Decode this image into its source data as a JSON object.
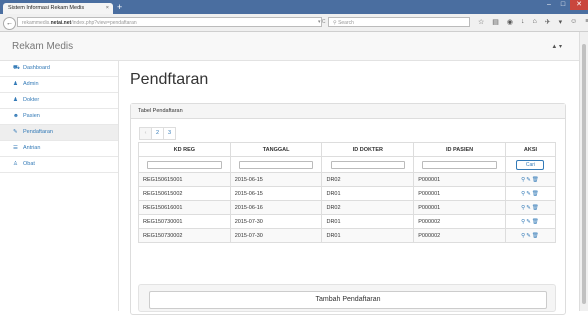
{
  "browser": {
    "tab_title": "Sistem Informasi Rekam Medis",
    "tab_close": "×",
    "new_tab": "+",
    "url_prefix": "rekammedis.",
    "url_domain": "netai.net",
    "url_suffix": "/index.php?view=pendaftaran",
    "reload": "▾ C",
    "search_placeholder": "Search"
  },
  "header": {
    "brand": "Rekam Medis",
    "user_menu": "▲ ▾"
  },
  "sidebar": {
    "items": [
      {
        "label": "Dashboard",
        "icon": "⛟"
      },
      {
        "label": "Admin",
        "icon": "♟"
      },
      {
        "label": "Dokter",
        "icon": "♟"
      },
      {
        "label": "Pasien",
        "icon": "☻"
      },
      {
        "label": "Pendaftaran",
        "icon": "✎"
      },
      {
        "label": "Antrian",
        "icon": "☰"
      },
      {
        "label": "Obat",
        "icon": "♙"
      }
    ]
  },
  "main": {
    "title": "Pendftaran",
    "panel_title": "Tabel Pendaftaran",
    "pagination": [
      "‹",
      "2",
      "3"
    ],
    "columns": [
      "KD REG",
      "TANGGAL",
      "ID DOKTER",
      "ID PASIEN",
      "AKSI"
    ],
    "search_button": "Cari",
    "rows": [
      [
        "REG150615001",
        "2015-06-15",
        "DR02",
        "P000001"
      ],
      [
        "REG150615002",
        "2015-06-15",
        "DR01",
        "P000001"
      ],
      [
        "REG150616001",
        "2015-06-16",
        "DR02",
        "P000001"
      ],
      [
        "REG150730001",
        "2015-07-30",
        "DR01",
        "P000002"
      ],
      [
        "REG150730002",
        "2015-07-30",
        "DR01",
        "P000002"
      ]
    ],
    "add_button": "Tambah Pendaftaran"
  }
}
